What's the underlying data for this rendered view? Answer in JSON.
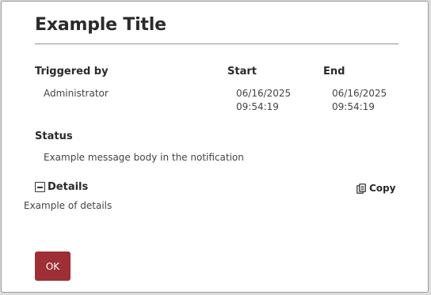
{
  "dialog": {
    "title": "Example Title"
  },
  "columns": {
    "triggered_by_label": "Triggered by",
    "start_label": "Start",
    "end_label": "End"
  },
  "values": {
    "triggered_by": "Administrator",
    "start_date": "06/16/2025",
    "start_time": "09:54:19",
    "end_date": "06/16/2025",
    "end_time": "09:54:19"
  },
  "status": {
    "label": "Status",
    "message": "Example message body in the notification"
  },
  "details": {
    "label": "Details",
    "text": "Example of details",
    "toggle_icon": "minus-square-icon"
  },
  "copy": {
    "label": "Copy",
    "icon": "copy-icon"
  },
  "footer": {
    "ok_label": "OK"
  },
  "colors": {
    "primary_button": "#9e2f35"
  }
}
